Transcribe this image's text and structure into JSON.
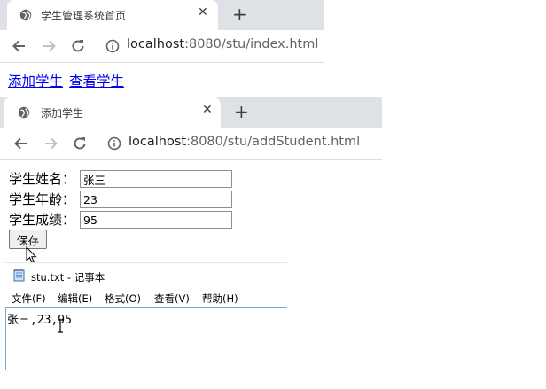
{
  "window1": {
    "tab_title": "学生管理系统首页",
    "tab_close": "✕",
    "new_tab": "+",
    "address": {
      "host": "localhost",
      "rest": ":8080/stu/index.html"
    },
    "links": [
      "添加学生",
      "查看学生"
    ]
  },
  "window2": {
    "tab_title": "添加学生",
    "tab_close": "✕",
    "new_tab": "+",
    "address": {
      "host": "localhost",
      "rest": ":8080/stu/addStudent.html"
    },
    "form": {
      "name_label": "学生姓名：",
      "name_value": "张三",
      "age_label": "学生年龄：",
      "age_value": "23",
      "score_label": "学生成绩：",
      "score_value": "95",
      "save_label": "保存"
    }
  },
  "notepad": {
    "title": "stu.txt - 记事本",
    "menu": [
      "文件(F)",
      "编辑(E)",
      "格式(O)",
      "查看(V)",
      "帮助(H)"
    ],
    "content": "张三,23,95"
  },
  "colors": {
    "tabstrip": "#dee1e6",
    "link": "#0000ee",
    "notepad_border": "#7aa6d6"
  }
}
